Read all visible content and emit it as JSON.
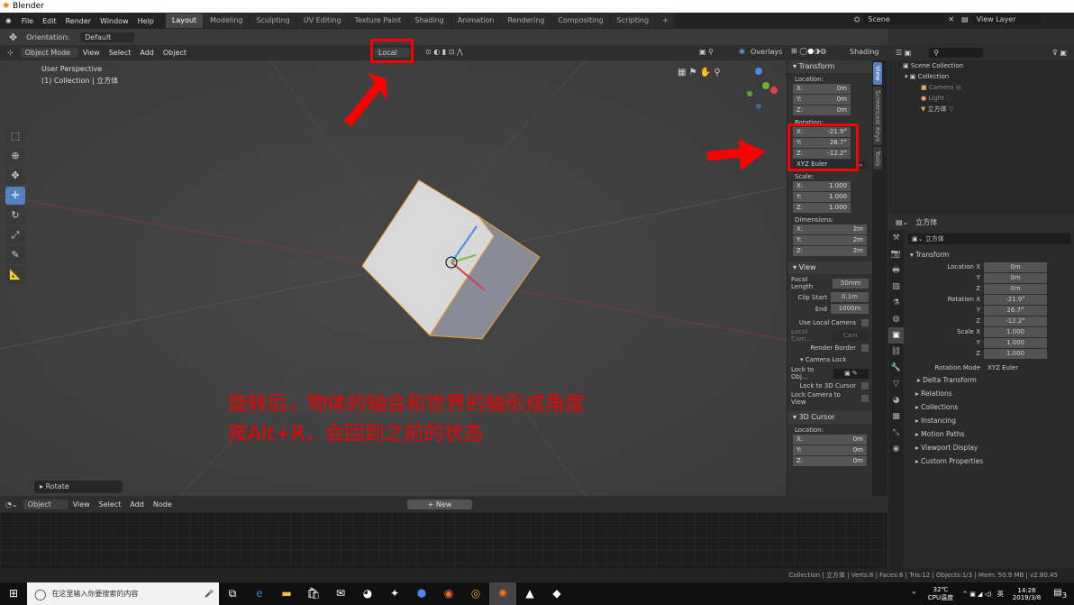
{
  "window": {
    "title": "Blender"
  },
  "menu": [
    "File",
    "Edit",
    "Render",
    "Window",
    "Help"
  ],
  "workspaces": [
    "Layout",
    "Modeling",
    "Sculpting",
    "UV Editing",
    "Texture Paint",
    "Shading",
    "Animation",
    "Rendering",
    "Compositing",
    "Scripting",
    "+"
  ],
  "scene": {
    "name": "Scene",
    "view_layer": "View Layer"
  },
  "toolheader": {
    "orientation_label": "Orientation:",
    "orientation_value": "Default"
  },
  "vpheader": {
    "mode": "Object Mode",
    "menus": [
      "View",
      "Select",
      "Add",
      "Object"
    ],
    "pivot": "Local",
    "overlays": "Overlays",
    "shading": "Shading"
  },
  "viewport": {
    "perspective": "User Perspective",
    "collection": "(1) Collection | 立方体",
    "last_op": "Rotate"
  },
  "annotation": {
    "line1": "旋转后，物体的轴会和世界的轴形成角度",
    "line2": "按Alt+R，会回到之前的状态",
    "color": "#ff0000"
  },
  "npanel": {
    "tabs": [
      "View",
      "Screencast Keys",
      "Tools"
    ],
    "transform": "Transform",
    "location_label": "Location:",
    "location": [
      {
        "k": "X:",
        "v": "0m"
      },
      {
        "k": "Y:",
        "v": "0m"
      },
      {
        "k": "Z:",
        "v": "0m"
      }
    ],
    "rotation_label": "Rotation:",
    "rotation": [
      {
        "k": "X:",
        "v": "-21.9°"
      },
      {
        "k": "Y:",
        "v": "26.7°"
      },
      {
        "k": "Z:",
        "v": "-12.2°"
      }
    ],
    "rotation_mode": "XYZ Euler",
    "scale_label": "Scale:",
    "scale": [
      {
        "k": "X:",
        "v": "1.000"
      },
      {
        "k": "Y:",
        "v": "1.000"
      },
      {
        "k": "Z:",
        "v": "1.000"
      }
    ],
    "dimensions_label": "Dimensions:",
    "dimensions": [
      {
        "k": "X:",
        "v": "2m"
      },
      {
        "k": "Y:",
        "v": "2m"
      },
      {
        "k": "Z:",
        "v": "2m"
      }
    ],
    "view": "View",
    "focal_length_label": "Focal Length",
    "focal_length": "50mm",
    "clip_start_label": "Clip Start",
    "clip_start": "0.1m",
    "clip_end_label": "End",
    "clip_end": "1000m",
    "use_local_camera": "Use Local Camera",
    "local_camera_label": "Local Cam...",
    "local_camera_value": "Cam",
    "render_border": "Render Border",
    "camera_lock": "Camera Lock",
    "lock_to_obj": "Lock to Obj...",
    "lock_to_cursor": "Lock to 3D Cursor",
    "lock_camera_view": "Lock Camera to View",
    "cursor": "3D Cursor",
    "cursor_location_label": "Location:",
    "cursor_location": [
      {
        "k": "X:",
        "v": "0m"
      },
      {
        "k": "Y:",
        "v": "0m"
      },
      {
        "k": "Z:",
        "v": "0m"
      }
    ]
  },
  "outliner": {
    "root": "Scene Collection",
    "collection": "Collection",
    "items": [
      "Camera",
      "Light",
      "立方体"
    ]
  },
  "properties": {
    "object_name": "立方体",
    "transform": "Transform",
    "rows": [
      {
        "k": "Location X",
        "v": "0m"
      },
      {
        "k": "Y",
        "v": "0m"
      },
      {
        "k": "Z",
        "v": "0m"
      },
      {
        "k": "Rotation X",
        "v": "-21.9°"
      },
      {
        "k": "Y",
        "v": "26.7°"
      },
      {
        "k": "Z",
        "v": "-12.2°"
      },
      {
        "k": "Scale X",
        "v": "1.000"
      },
      {
        "k": "Y",
        "v": "1.000"
      },
      {
        "k": "Z",
        "v": "1.000"
      }
    ],
    "rotation_mode_label": "Rotation Mode",
    "rotation_mode": "XYZ Euler",
    "delta": "Delta Transform",
    "sections": [
      "Relations",
      "Collections",
      "Instancing",
      "Motion Paths",
      "Viewport Display",
      "Custom Properties"
    ]
  },
  "shader": {
    "mode": "Object",
    "menus": [
      "View",
      "Select",
      "Add",
      "Node"
    ],
    "new": "New"
  },
  "status": "Collection | 立方体 | Verts:8 | Faces:6 | Tris:12 | Objects:1/3 | Mem: 50.9 MB | v2.80.45",
  "taskbar": {
    "search_placeholder": "在这里输入你要搜索的内容",
    "temp": "32℃",
    "temp_label": "CPU温度",
    "ime": "英",
    "time": "14:26",
    "date": "2019/3/8",
    "notifications": "3"
  }
}
